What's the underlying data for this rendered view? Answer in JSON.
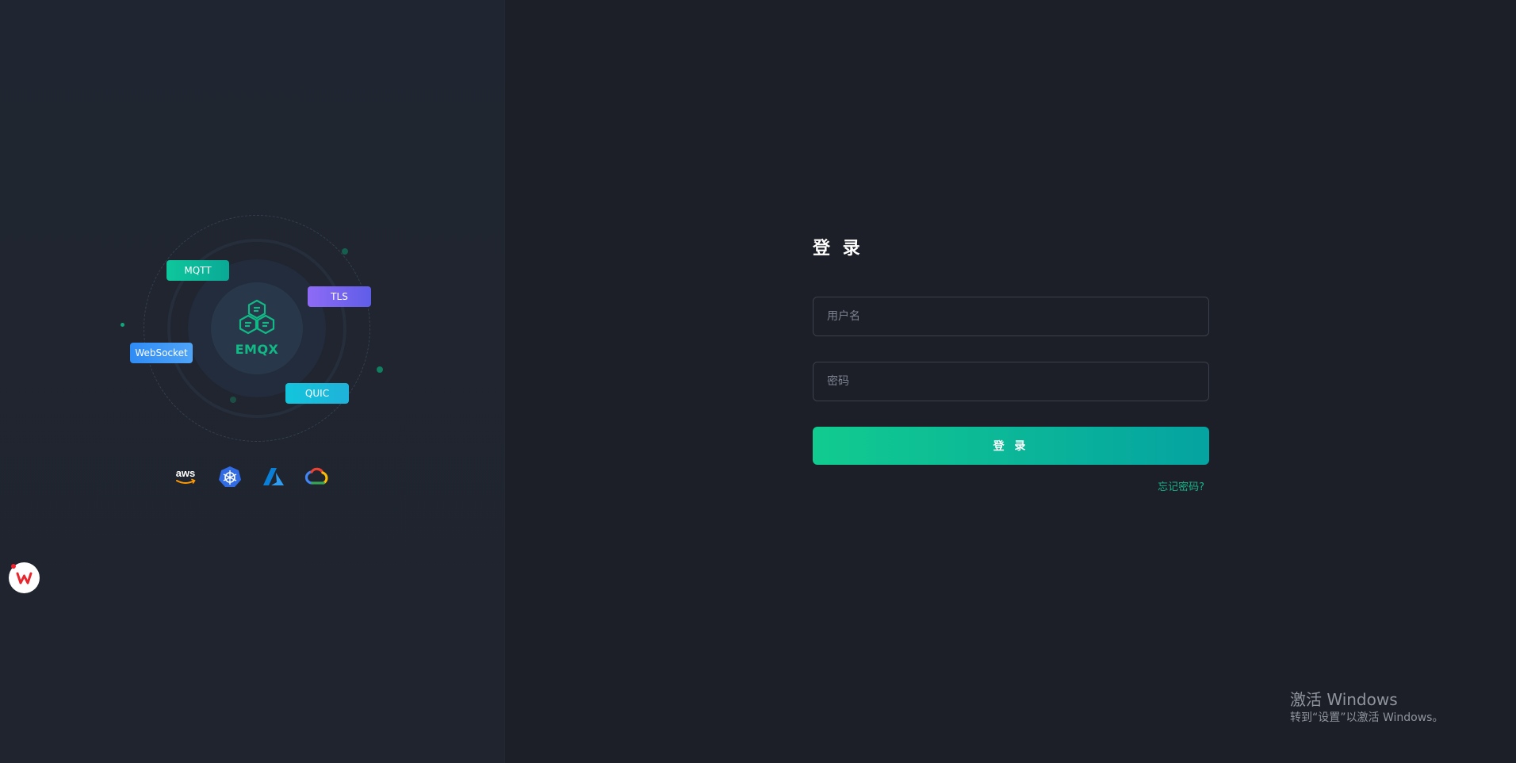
{
  "brand": {
    "name": "EMQX",
    "color": "#11b986"
  },
  "protocols": {
    "mqtt": "MQTT",
    "tls": "TLS",
    "websocket": "WebSocket",
    "quic": "QUIC"
  },
  "cloud_icons": [
    "aws-icon",
    "kubernetes-icon",
    "azure-icon",
    "google-cloud-icon"
  ],
  "cloud_labels": {
    "aws": "aws"
  },
  "login": {
    "title": "登 录",
    "username_placeholder": "用户名",
    "password_placeholder": "密码",
    "submit_label": "登 录",
    "forgot_label": "忘记密码?"
  },
  "watermark": {
    "title": "激活 Windows",
    "subtitle": "转到“设置”以激活 Windows。"
  },
  "colors": {
    "accent_start": "#11cb8f",
    "accent_end": "#05a3a1",
    "link": "#17b38b",
    "background": "#1c1f28"
  }
}
